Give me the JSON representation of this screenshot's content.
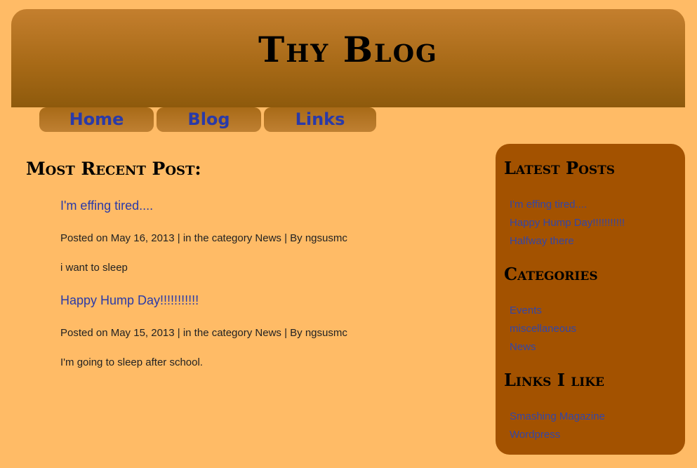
{
  "header": {
    "site_title": "Thy Blog"
  },
  "nav": {
    "items": [
      {
        "label": "Home"
      },
      {
        "label": "Blog"
      },
      {
        "label": "Links"
      }
    ]
  },
  "main": {
    "heading": "Most Recent Post:",
    "posts": [
      {
        "title": "I'm effing tired....",
        "meta": "Posted on May 16, 2013 | in the category News | By ngsusmc",
        "body": "i want to sleep"
      },
      {
        "title": "Happy Hump Day!!!!!!!!!!!",
        "meta": "Posted on May 15, 2013 | in the category News | By ngsusmc",
        "body": "I'm going to sleep after school."
      }
    ]
  },
  "sidebar": {
    "latest_posts": {
      "heading": "Latest Posts",
      "items": [
        "I'm effing tired....",
        "Happy Hump Day!!!!!!!!!!!",
        "Halfway there"
      ]
    },
    "categories": {
      "heading": "Categories",
      "items": [
        "Events",
        "miscellaneous",
        "News"
      ]
    },
    "links": {
      "heading": "Links I like",
      "items": [
        "Smashing Magazine",
        "Wordpress"
      ]
    }
  },
  "colors": {
    "background": "#ffbb66",
    "header_gradient_top": "#c47f2e",
    "header_gradient_bottom": "#8e5a0c",
    "sidebar": "#a35200",
    "link": "#2a3aa8"
  }
}
